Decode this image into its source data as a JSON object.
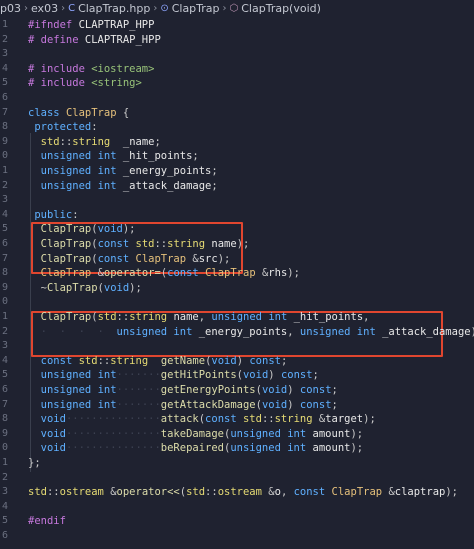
{
  "breadcrumb": {
    "items": [
      "p03",
      "ex03",
      "ClapTrap.hpp",
      "ClapTrap",
      "ClapTrap(void)"
    ]
  },
  "lines": [
    {
      "num": "1",
      "tokens": [
        [
          "pp",
          "#ifndef "
        ],
        [
          "id",
          "CLAPTRAP_HPP"
        ]
      ]
    },
    {
      "num": "2",
      "tokens": [
        [
          "pp",
          "# define "
        ],
        [
          "id",
          "CLAPTRAP_HPP"
        ]
      ]
    },
    {
      "num": "3",
      "tokens": []
    },
    {
      "num": "4",
      "tokens": [
        [
          "pp",
          "# include "
        ],
        [
          "str",
          "<iostream>"
        ]
      ]
    },
    {
      "num": "5",
      "tokens": [
        [
          "pp",
          "# include "
        ],
        [
          "str",
          "<string>"
        ]
      ]
    },
    {
      "num": "6",
      "tokens": []
    },
    {
      "num": "7",
      "tokens": [
        [
          "kw",
          "class "
        ],
        [
          "cls",
          "ClapTrap "
        ],
        [
          "pu",
          "{"
        ]
      ]
    },
    {
      "num": "8",
      "tokens": [
        [
          "kw",
          " protected"
        ],
        [
          "pu",
          ":"
        ]
      ]
    },
    {
      "num": "9",
      "tokens": [
        [
          "pu",
          "  "
        ],
        [
          "ty",
          "std"
        ],
        [
          "pu",
          "::"
        ],
        [
          "ty",
          "string"
        ],
        [
          "dot",
          "  "
        ],
        [
          "id",
          "_name"
        ],
        [
          "pu",
          ";"
        ]
      ]
    },
    {
      "num": "0",
      "tokens": [
        [
          "pu",
          "  "
        ],
        [
          "kw",
          "unsigned "
        ],
        [
          "kw",
          "int "
        ],
        [
          "id",
          "_hit_points"
        ],
        [
          "pu",
          ";"
        ]
      ]
    },
    {
      "num": "1",
      "tokens": [
        [
          "pu",
          "  "
        ],
        [
          "kw",
          "unsigned "
        ],
        [
          "kw",
          "int "
        ],
        [
          "id",
          "_energy_points"
        ],
        [
          "pu",
          ";"
        ]
      ]
    },
    {
      "num": "2",
      "tokens": [
        [
          "pu",
          "  "
        ],
        [
          "kw",
          "unsigned "
        ],
        [
          "kw",
          "int "
        ],
        [
          "id",
          "_attack_damage"
        ],
        [
          "pu",
          ";"
        ]
      ]
    },
    {
      "num": "3",
      "tokens": []
    },
    {
      "num": "4",
      "tokens": [
        [
          "kw",
          " public"
        ],
        [
          "pu",
          ":"
        ]
      ]
    },
    {
      "num": "5",
      "tokens": [
        [
          "pu",
          "  "
        ],
        [
          "fn",
          "ClapTrap"
        ],
        [
          "pu",
          "("
        ],
        [
          "kw",
          "void"
        ],
        [
          "pu",
          ");"
        ]
      ]
    },
    {
      "num": "6",
      "tokens": [
        [
          "pu",
          "  "
        ],
        [
          "fn",
          "ClapTrap"
        ],
        [
          "pu",
          "("
        ],
        [
          "kw",
          "const "
        ],
        [
          "ty",
          "std"
        ],
        [
          "pu",
          "::"
        ],
        [
          "ty",
          "string "
        ],
        [
          "id",
          "name"
        ],
        [
          "pu",
          ");"
        ]
      ]
    },
    {
      "num": "7",
      "tokens": [
        [
          "pu",
          "  "
        ],
        [
          "fn",
          "ClapTrap"
        ],
        [
          "pu",
          "("
        ],
        [
          "kw",
          "const "
        ],
        [
          "cls",
          "ClapTrap "
        ],
        [
          "pu",
          "&"
        ],
        [
          "id",
          "src"
        ],
        [
          "pu",
          ");"
        ]
      ]
    },
    {
      "num": "8",
      "tokens": [
        [
          "pu",
          "  "
        ],
        [
          "cls",
          "ClapTrap "
        ],
        [
          "pu",
          "&"
        ],
        [
          "fn",
          "operator="
        ],
        [
          "pu",
          "("
        ],
        [
          "kw",
          "const "
        ],
        [
          "cls",
          "ClapTrap "
        ],
        [
          "pu",
          "&"
        ],
        [
          "id",
          "rhs"
        ],
        [
          "pu",
          ");"
        ]
      ]
    },
    {
      "num": "9",
      "tokens": [
        [
          "pu",
          "  ~"
        ],
        [
          "fn",
          "ClapTrap"
        ],
        [
          "pu",
          "("
        ],
        [
          "kw",
          "void"
        ],
        [
          "pu",
          ");"
        ]
      ]
    },
    {
      "num": "0",
      "tokens": []
    },
    {
      "num": "1",
      "tokens": [
        [
          "pu",
          "  "
        ],
        [
          "fn",
          "ClapTrap"
        ],
        [
          "pu",
          "("
        ],
        [
          "ty",
          "std"
        ],
        [
          "pu",
          "::"
        ],
        [
          "ty",
          "string "
        ],
        [
          "id",
          "name"
        ],
        [
          "pu",
          ", "
        ],
        [
          "kw",
          "unsigned "
        ],
        [
          "kw",
          "int "
        ],
        [
          "id",
          "_hit_points"
        ],
        [
          "pu",
          ","
        ]
      ]
    },
    {
      "num": "2",
      "tokens": [
        [
          "dot",
          "  ·  ·  ·  ·  "
        ],
        [
          "kw",
          "unsigned "
        ],
        [
          "kw",
          "int "
        ],
        [
          "id",
          "_energy_points"
        ],
        [
          "pu",
          ", "
        ],
        [
          "kw",
          "unsigned "
        ],
        [
          "kw",
          "int "
        ],
        [
          "id",
          "_attack_damage"
        ],
        [
          "pu",
          ");"
        ]
      ]
    },
    {
      "num": "3",
      "tokens": []
    },
    {
      "num": "4",
      "tokens": [
        [
          "pu",
          "  "
        ],
        [
          "kw",
          "const "
        ],
        [
          "ty",
          "std"
        ],
        [
          "pu",
          "::"
        ],
        [
          "ty",
          "string"
        ],
        [
          "dot",
          "  "
        ],
        [
          "fn",
          "getName"
        ],
        [
          "pu",
          "("
        ],
        [
          "kw",
          "void"
        ],
        [
          "pu",
          ") "
        ],
        [
          "kw",
          "const"
        ],
        [
          "pu",
          ";"
        ]
      ]
    },
    {
      "num": "5",
      "tokens": [
        [
          "pu",
          "  "
        ],
        [
          "kw",
          "unsigned "
        ],
        [
          "kw",
          "int"
        ],
        [
          "dot",
          "·······"
        ],
        [
          "fn",
          "getHitPoints"
        ],
        [
          "pu",
          "("
        ],
        [
          "kw",
          "void"
        ],
        [
          "pu",
          ") "
        ],
        [
          "kw",
          "const"
        ],
        [
          "pu",
          ";"
        ]
      ]
    },
    {
      "num": "6",
      "tokens": [
        [
          "pu",
          "  "
        ],
        [
          "kw",
          "unsigned "
        ],
        [
          "kw",
          "int"
        ],
        [
          "dot",
          "·······"
        ],
        [
          "fn",
          "getEnergyPoints"
        ],
        [
          "pu",
          "("
        ],
        [
          "kw",
          "void"
        ],
        [
          "pu",
          ") "
        ],
        [
          "kw",
          "const"
        ],
        [
          "pu",
          ";"
        ]
      ]
    },
    {
      "num": "7",
      "tokens": [
        [
          "pu",
          "  "
        ],
        [
          "kw",
          "unsigned "
        ],
        [
          "kw",
          "int"
        ],
        [
          "dot",
          "·······"
        ],
        [
          "fn",
          "getAttackDamage"
        ],
        [
          "pu",
          "("
        ],
        [
          "kw",
          "void"
        ],
        [
          "pu",
          ") "
        ],
        [
          "kw",
          "const"
        ],
        [
          "pu",
          ";"
        ]
      ]
    },
    {
      "num": "8",
      "tokens": [
        [
          "pu",
          "  "
        ],
        [
          "kw",
          "void"
        ],
        [
          "dot",
          "···············"
        ],
        [
          "fn",
          "attack"
        ],
        [
          "pu",
          "("
        ],
        [
          "kw",
          "const "
        ],
        [
          "ty",
          "std"
        ],
        [
          "pu",
          "::"
        ],
        [
          "ty",
          "string "
        ],
        [
          "pu",
          "&"
        ],
        [
          "id",
          "target"
        ],
        [
          "pu",
          ");"
        ]
      ]
    },
    {
      "num": "9",
      "tokens": [
        [
          "pu",
          "  "
        ],
        [
          "kw",
          "void"
        ],
        [
          "dot",
          "···············"
        ],
        [
          "fn",
          "takeDamage"
        ],
        [
          "pu",
          "("
        ],
        [
          "kw",
          "unsigned "
        ],
        [
          "kw",
          "int "
        ],
        [
          "id",
          "amount"
        ],
        [
          "pu",
          ");"
        ]
      ]
    },
    {
      "num": "0",
      "tokens": [
        [
          "pu",
          "  "
        ],
        [
          "kw",
          "void"
        ],
        [
          "dot",
          "···············"
        ],
        [
          "fn",
          "beRepaired"
        ],
        [
          "pu",
          "("
        ],
        [
          "kw",
          "unsigned "
        ],
        [
          "kw",
          "int "
        ],
        [
          "id",
          "amount"
        ],
        [
          "pu",
          ");"
        ]
      ]
    },
    {
      "num": "1",
      "tokens": [
        [
          "pu",
          "};"
        ]
      ]
    },
    {
      "num": "2",
      "tokens": []
    },
    {
      "num": "3",
      "tokens": [
        [
          "ty",
          "std"
        ],
        [
          "pu",
          "::"
        ],
        [
          "ty",
          "ostream "
        ],
        [
          "pu",
          "&"
        ],
        [
          "fn",
          "operator<<"
        ],
        [
          "pu",
          "("
        ],
        [
          "ty",
          "std"
        ],
        [
          "pu",
          "::"
        ],
        [
          "ty",
          "ostream "
        ],
        [
          "pu",
          "&"
        ],
        [
          "id",
          "o"
        ],
        [
          "pu",
          ", "
        ],
        [
          "kw",
          "const "
        ],
        [
          "cls",
          "ClapTrap "
        ],
        [
          "pu",
          "&"
        ],
        [
          "id",
          "claptrap"
        ],
        [
          "pu",
          ");"
        ]
      ]
    },
    {
      "num": "4",
      "tokens": []
    },
    {
      "num": "5",
      "tokens": [
        [
          "pp",
          "#endif"
        ]
      ]
    },
    {
      "num": "6",
      "tokens": []
    }
  ]
}
